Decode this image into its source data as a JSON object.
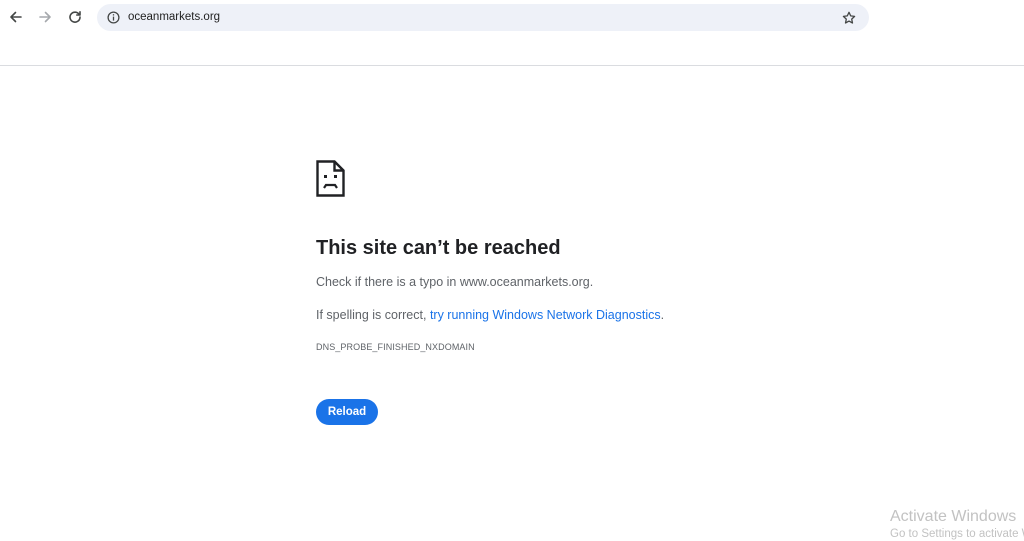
{
  "toolbar": {
    "url": "oceanmarkets.org",
    "icons": {
      "back": "arrow-left-icon",
      "forward": "arrow-right-icon",
      "reload": "reload-icon",
      "site_info": "info-circle-icon",
      "bookmark": "star-outline-icon"
    }
  },
  "error_page": {
    "icon": "sad-document-icon",
    "title": "This site can’t be reached",
    "message_typo": "Check if there is a typo in www.oceanmarkets.org.",
    "message_spelling_prefix": "If spelling is correct,",
    "diagnostics_link": "try running Windows Network Diagnostics",
    "message_spelling_suffix": ".",
    "error_code": "DNS_PROBE_FINISHED_NXDOMAIN",
    "reload_label": "Reload"
  },
  "watermark": {
    "title": "Activate Windows",
    "subtitle": "Go to Settings to activate Windows."
  },
  "colors": {
    "accent": "#1a73e8",
    "omnibox_bg": "#eef1f8",
    "text_primary": "#202124",
    "text_secondary": "#5f6368"
  }
}
